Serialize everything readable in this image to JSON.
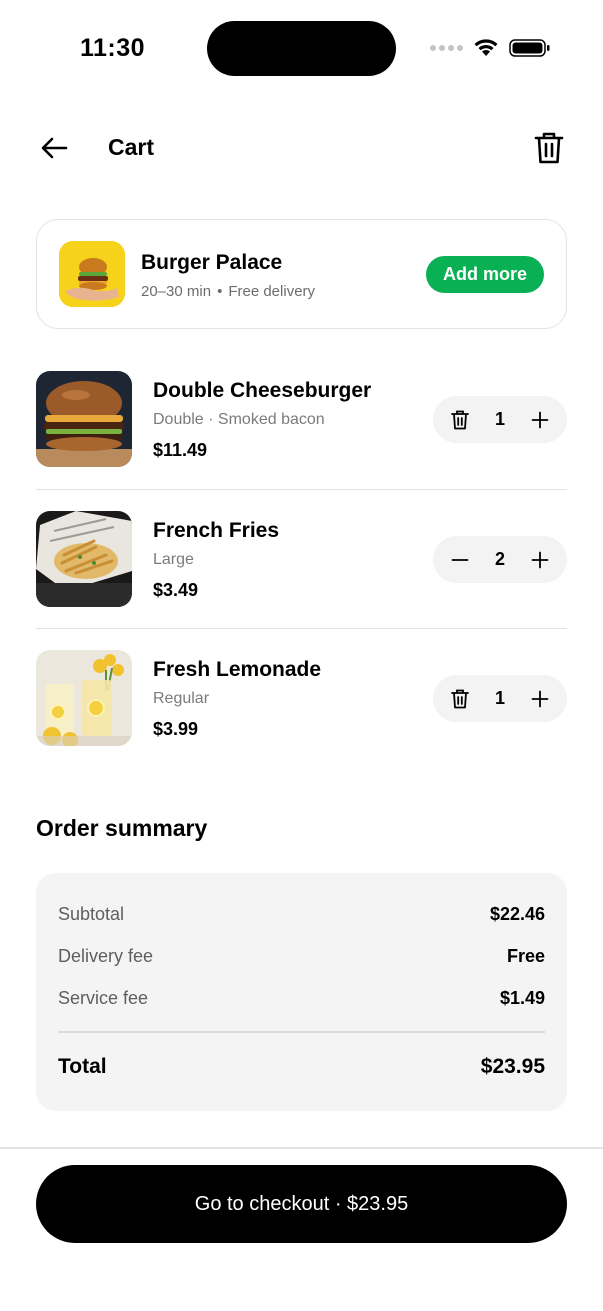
{
  "status_bar": {
    "time": "11:30"
  },
  "header": {
    "title": "Cart"
  },
  "restaurant": {
    "name": "Burger Palace",
    "eta": "20–30 min",
    "separator": "•",
    "delivery": "Free delivery",
    "add_more_label": "Add more"
  },
  "items": [
    {
      "name": "Double Cheeseburger",
      "variant": "Double · Smoked bacon",
      "price": "$11.49",
      "qty": "1",
      "minus_icon": "trash-icon"
    },
    {
      "name": "French Fries",
      "variant": "Large",
      "price": "$3.49",
      "qty": "2",
      "minus_icon": "minus-icon"
    },
    {
      "name": "Fresh Lemonade",
      "variant": "Regular",
      "price": "$3.99",
      "qty": "1",
      "minus_icon": "trash-icon"
    }
  ],
  "summary": {
    "title": "Order summary",
    "rows": [
      {
        "label": "Subtotal",
        "value": "$22.46"
      },
      {
        "label": "Delivery fee",
        "value": "Free"
      },
      {
        "label": "Service fee",
        "value": "$1.49"
      }
    ],
    "total": {
      "label": "Total",
      "value": "$23.95"
    }
  },
  "checkout": {
    "label": "Go to checkout · $23.95"
  },
  "colors": {
    "accent_green": "#0ab054",
    "primary": "#000000"
  }
}
